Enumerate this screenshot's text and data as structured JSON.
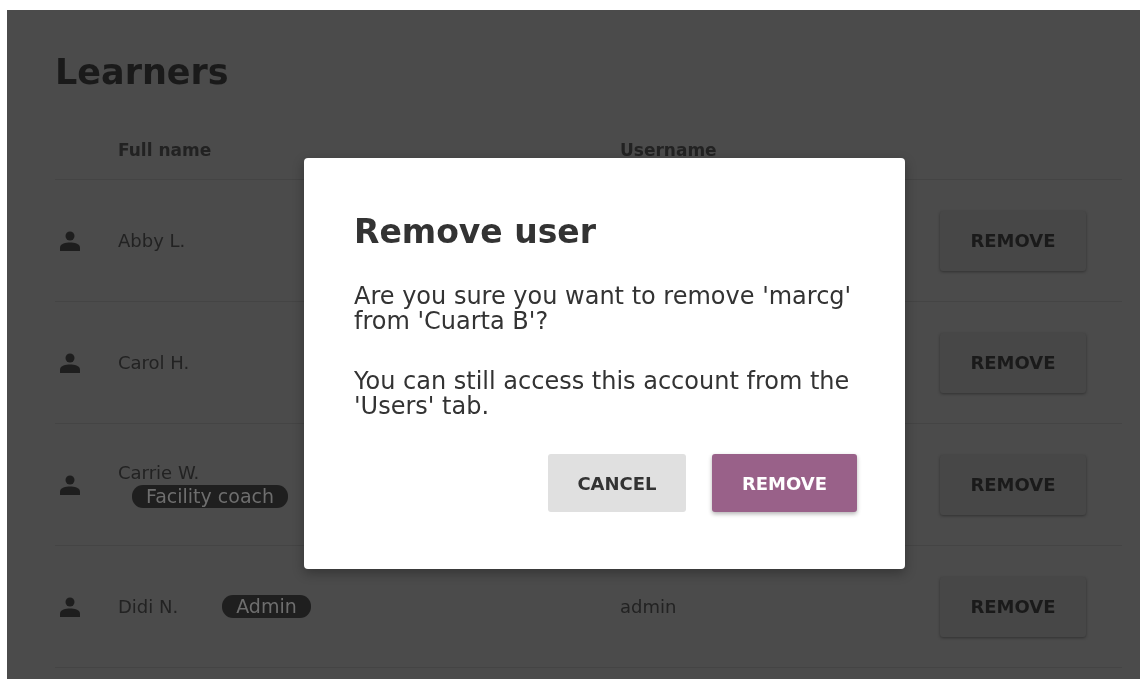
{
  "section_title": "Learners",
  "table": {
    "columns": [
      "Full name",
      "Username"
    ],
    "rows": [
      {
        "full_name": "Abby L.",
        "action": "REMOVE"
      },
      {
        "full_name": "Carol H.",
        "action": "REMOVE"
      },
      {
        "full_name": "Carrie W.",
        "badge": "Facility coach",
        "action": "REMOVE"
      },
      {
        "full_name": "Didi N.",
        "badge": "Admin",
        "username": "admin",
        "action": "REMOVE"
      }
    ]
  },
  "dialog": {
    "title": "Remove user",
    "paragraphs": [
      "Are you sure you want to remove 'marcg' from 'Cuarta B'?",
      "You can still access this account from the 'Users' tab."
    ],
    "buttons": [
      {
        "label": "CANCEL",
        "kind": "secondary"
      },
      {
        "label": "REMOVE",
        "kind": "primary"
      }
    ]
  }
}
